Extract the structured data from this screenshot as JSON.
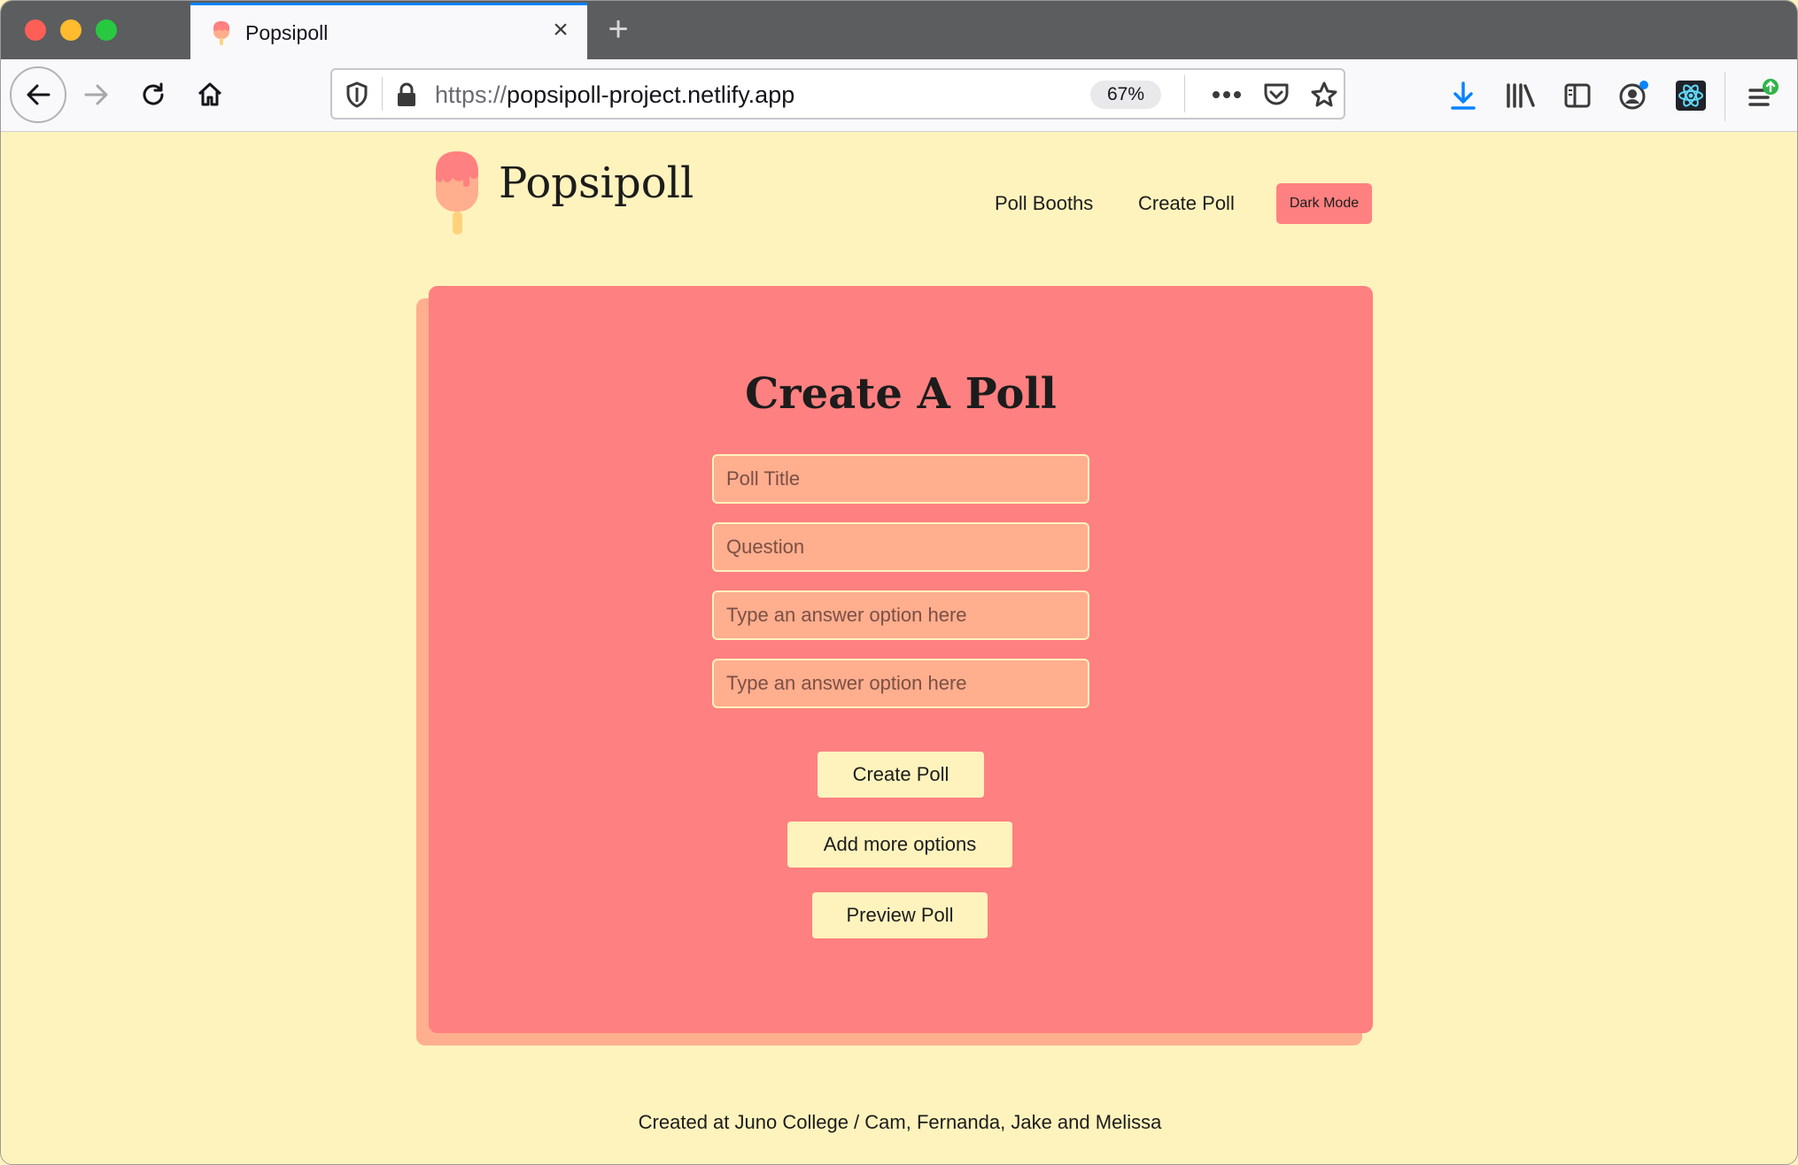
{
  "browser": {
    "tab": {
      "title": "Popsipoll",
      "close_icon": "×"
    },
    "new_tab_icon": "+",
    "url": {
      "scheme": "https://",
      "host": "popsipoll-project.netlify.app"
    },
    "zoom": "67%"
  },
  "site": {
    "title": "Popsipoll",
    "nav": {
      "booths": "Poll Booths",
      "create": "Create Poll",
      "dark_mode": "Dark Mode"
    }
  },
  "form": {
    "heading": "Create A Poll",
    "fields": {
      "title_placeholder": "Poll Title",
      "question_placeholder": "Question",
      "option1_placeholder": "Type an answer option here",
      "option2_placeholder": "Type an answer option here"
    },
    "buttons": {
      "create": "Create Poll",
      "add_more": "Add more options",
      "preview": "Preview Poll"
    }
  },
  "footer": {
    "text": "Created at Juno College / Cam, Fernanda, Jake and Melissa"
  },
  "colors": {
    "page_bg": "#fff3bd",
    "card": "#ff8080",
    "card_shadow": "#ffae8e",
    "input_bg": "#ffae8e",
    "accent_blue": "#0a84ff"
  }
}
